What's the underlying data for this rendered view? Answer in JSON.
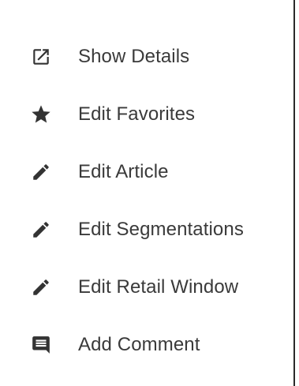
{
  "menu": {
    "items": [
      {
        "label": "Show Details",
        "icon": "open-in-new-icon"
      },
      {
        "label": "Edit Favorites",
        "icon": "star-icon"
      },
      {
        "label": "Edit Article",
        "icon": "pencil-icon"
      },
      {
        "label": "Edit Segmentations",
        "icon": "pencil-icon"
      },
      {
        "label": "Edit Retail Window",
        "icon": "pencil-icon"
      },
      {
        "label": "Add Comment",
        "icon": "comment-icon"
      }
    ]
  },
  "colors": {
    "icon": "#333333",
    "text": "#3a3a3a",
    "border": "#2a2a2a",
    "background": "#ffffff"
  }
}
